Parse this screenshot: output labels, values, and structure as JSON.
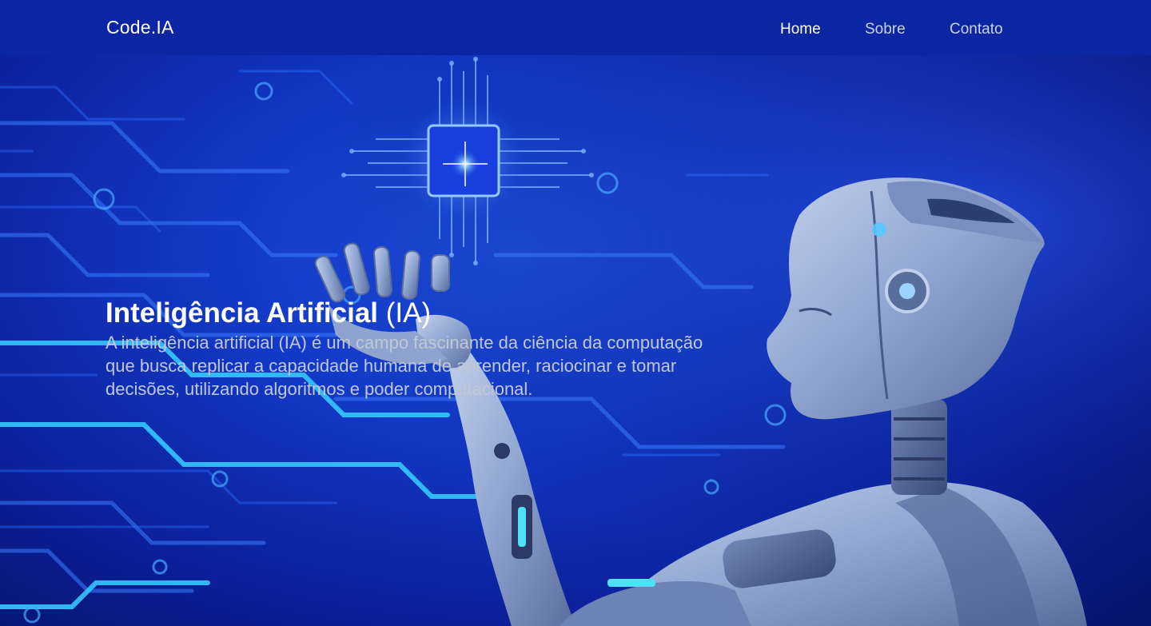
{
  "header": {
    "logo": "Code.IA",
    "nav": [
      {
        "label": "Home",
        "active": true
      },
      {
        "label": "Sobre",
        "active": false
      },
      {
        "label": "Contato",
        "active": false
      }
    ]
  },
  "hero": {
    "title_bold": "Inteligência Artificial",
    "title_rest": " (IA)",
    "description": "A inteligência artificial (IA) é um campo fascinante da ciência da computação que busca replicar a capacidade humana de aprender, raciocinar e tomar decisões, utilizando algoritmos e poder computacional."
  },
  "background": {
    "image": "robot-and-circuit-illustration",
    "colors": {
      "header": "#0c25a3",
      "background": "#1238c4",
      "circuit": "#2fb8ff",
      "robot": "#8ea4cf"
    }
  }
}
